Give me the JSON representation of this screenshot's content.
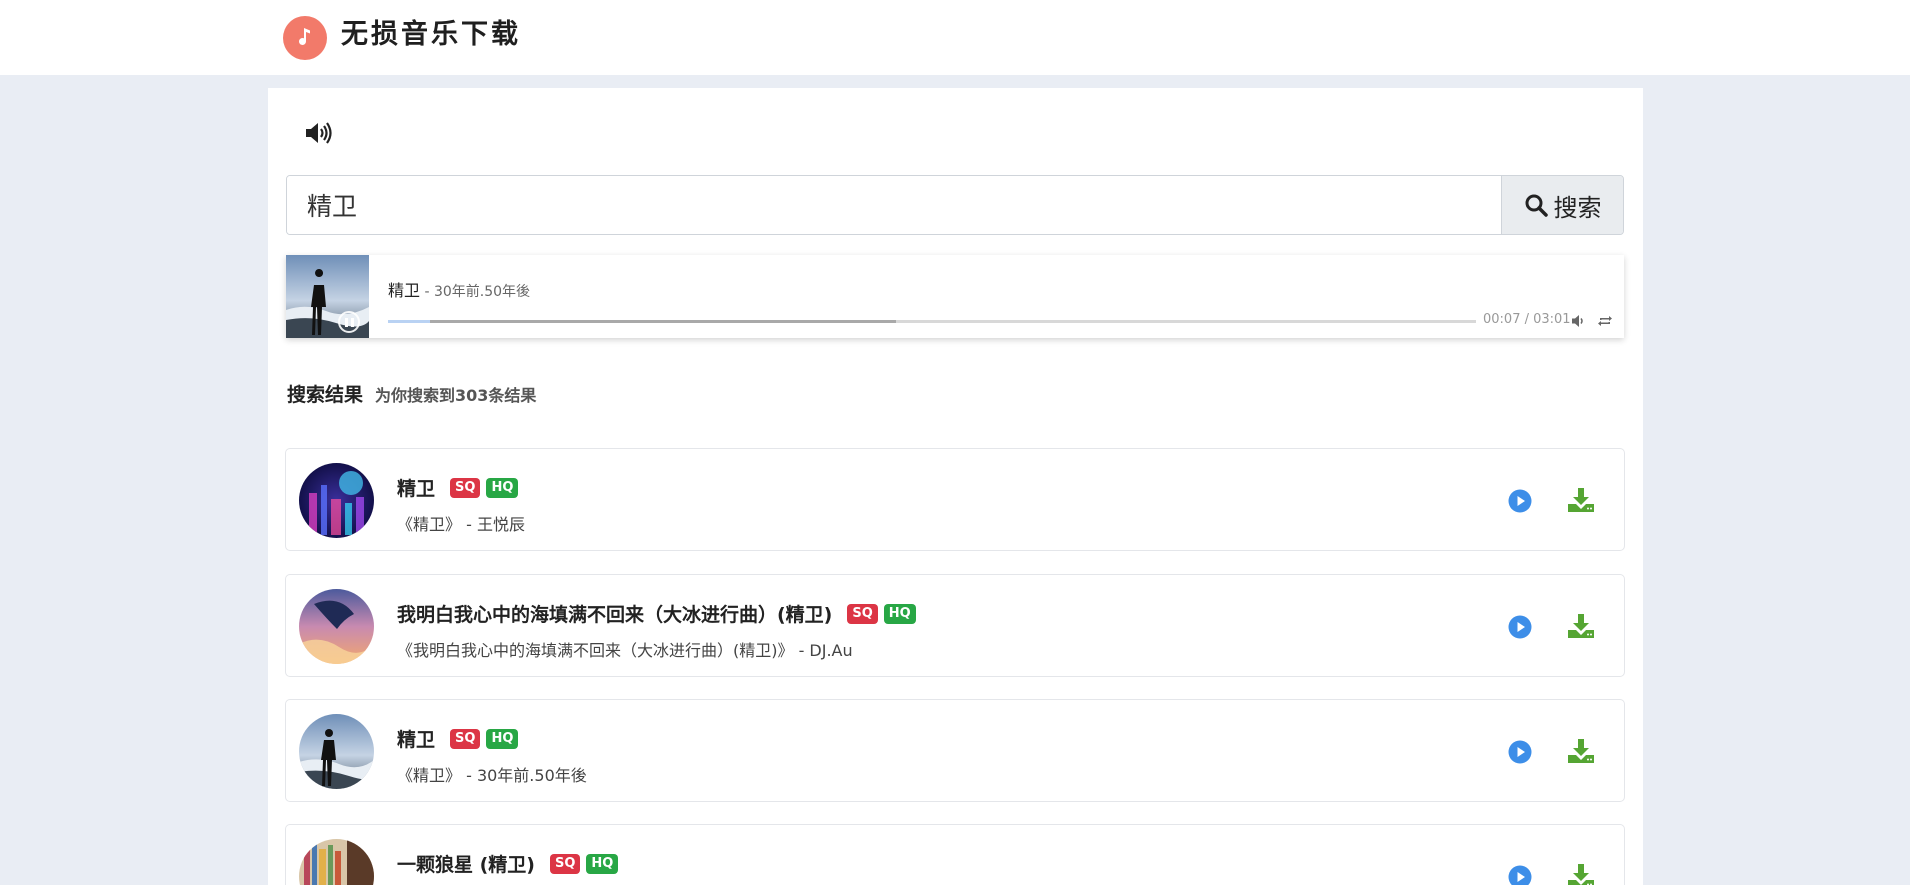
{
  "header": {
    "brand": "无损音乐下载",
    "logo_icon": "music-note-icon",
    "logo_color": "#f27a6a"
  },
  "search": {
    "value": "精卫",
    "button_label": "搜索"
  },
  "player": {
    "title": "精卫",
    "artist": " - 30年前.50年後",
    "time": "00:07 / 03:01",
    "played_fraction": 0.039,
    "buffered_fraction": 0.467
  },
  "results": {
    "title": "搜索结果",
    "count_text": "为你搜索到303条结果"
  },
  "songs": [
    {
      "name": "精卫",
      "sq": "SQ",
      "hq": "HQ",
      "sub": "《精卫》 - 王悦辰"
    },
    {
      "name": "我明白我心中的海填满不回来（大冰进行曲）(精卫)",
      "sq": "SQ",
      "hq": "HQ",
      "sub": "《我明白我心中的海填满不回来（大冰进行曲）(精卫)》 - DJ.Au"
    },
    {
      "name": "精卫",
      "sq": "SQ",
      "hq": "HQ",
      "sub": "《精卫》 - 30年前.50年後"
    },
    {
      "name": "一颗狼星 (精卫)",
      "sq": "SQ",
      "hq": "HQ",
      "sub": ""
    }
  ],
  "colors": {
    "sq": "#dc3545",
    "hq": "#28a745",
    "play": "#3d8ee8",
    "download": "#55a533"
  }
}
